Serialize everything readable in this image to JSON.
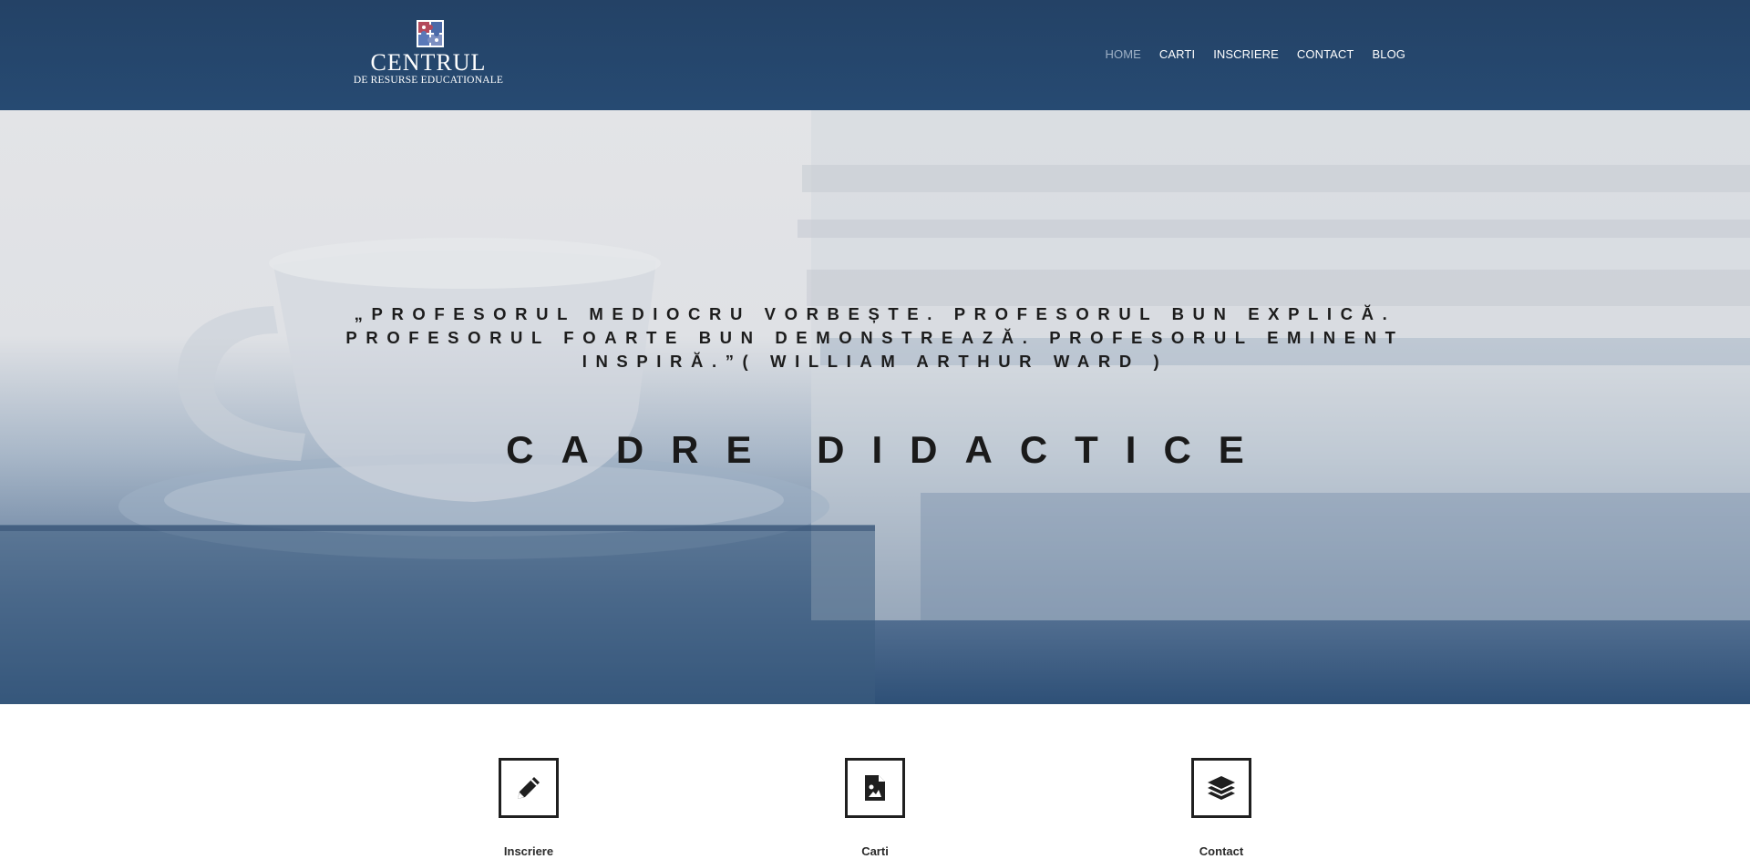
{
  "brand": {
    "title": "Centrul",
    "subtitle": "de Resurse Educationale"
  },
  "nav": {
    "items": [
      {
        "label": "HOME",
        "active": true
      },
      {
        "label": "CARTI",
        "active": false
      },
      {
        "label": "INSCRIERE",
        "active": false
      },
      {
        "label": "CONTACT",
        "active": false
      },
      {
        "label": "BLOG",
        "active": false
      }
    ]
  },
  "hero": {
    "quote_line1": "„Profesorul mediocru vorbește. Profesorul bun explică.",
    "quote_line2": "Profesorul foarte bun demonstrează. Profesorul eminent",
    "quote_line3": "inspiră.”( William Arthur Ward )",
    "title": "CADRE DIDACTICE"
  },
  "features": [
    {
      "label": "Inscriere",
      "icon": "pencil-icon"
    },
    {
      "label": "Carti",
      "icon": "image-file-icon"
    },
    {
      "label": "Contact",
      "icon": "layers-icon"
    }
  ],
  "colors": {
    "header_bg": "#244266",
    "nav_active": "#9fb1c6",
    "hero_bottom": "#2e5077"
  }
}
